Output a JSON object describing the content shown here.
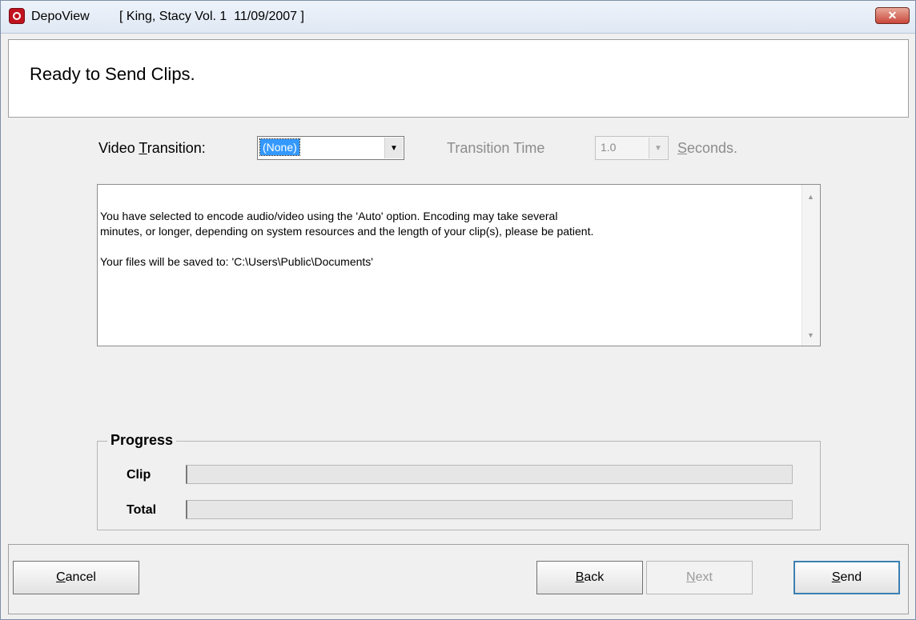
{
  "window": {
    "app_name": "DepoView",
    "subtitle": "[ King, Stacy Vol. 1  11/09/2007 ]",
    "close_glyph": "✕"
  },
  "header": {
    "title": "Ready to Send Clips."
  },
  "video_transition": {
    "label_prefix": "Video ",
    "label_accel": "T",
    "label_suffix": "ransition:",
    "value": "(None)",
    "arrow": "▼"
  },
  "transition_time": {
    "label": "Transition Time",
    "value": "1.0",
    "arrow": "▼",
    "unit_accel": "S",
    "unit_rest": "econds."
  },
  "info": {
    "message": "You have selected to encode audio/video using the 'Auto' option. Encoding may take several\nminutes, or longer, depending on system resources and the length of your clip(s), please be patient.\n\nYour files will be saved to: 'C:\\Users\\Public\\Documents'",
    "scroll_up": "▲",
    "scroll_down": "▼"
  },
  "progress": {
    "title": "Progress",
    "clip_label": "Clip",
    "clip_fraction": 0,
    "total_label": "Total",
    "total_fraction": 0
  },
  "buttons": {
    "cancel_accel": "C",
    "cancel_rest": "ancel",
    "back_accel": "B",
    "back_rest": "ack",
    "next_accel": "N",
    "next_rest": "ext",
    "send_accel": "S",
    "send_rest": "end"
  },
  "colors": {
    "title_bar": "#dfe8f4",
    "close": "#c9473a",
    "selection": "#3399ff",
    "default_button": "#3c7fb1"
  },
  "icons": {
    "app": "depoview-logo-icon",
    "close": "close-icon",
    "dropdown": "chevron-down-icon"
  }
}
